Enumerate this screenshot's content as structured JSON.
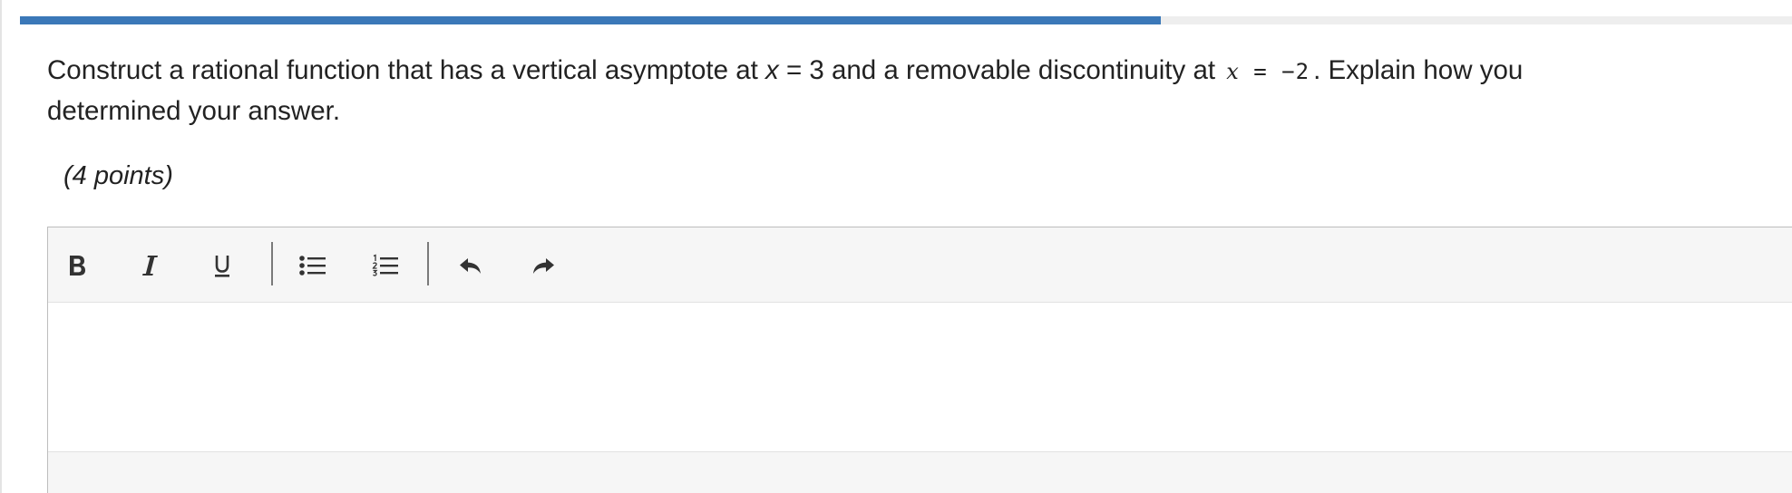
{
  "progress": {
    "fraction": 0.644,
    "color": "#3b78b8"
  },
  "question": {
    "line1_part1": "Construct a rational function that has a vertical asymptote at ",
    "var_x": "x",
    "line1_part2": " = 3 and a removable discontinuity at ",
    "math_x": "x",
    "math_rest": " = −2",
    "line1_part3": ". Explain how you",
    "line2": "determined your answer."
  },
  "points_label": "(4 points)",
  "toolbar": {
    "buttons": [
      {
        "name": "bold",
        "icon": "bold-icon"
      },
      {
        "name": "italic",
        "icon": "italic-icon"
      },
      {
        "name": "underline",
        "icon": "underline-icon"
      },
      {
        "name": "bulleted-list",
        "icon": "bulleted-list-icon"
      },
      {
        "name": "numbered-list",
        "icon": "numbered-list-icon"
      },
      {
        "name": "undo",
        "icon": "undo-icon"
      },
      {
        "name": "redo",
        "icon": "redo-icon"
      }
    ]
  },
  "editor": {
    "content": ""
  }
}
